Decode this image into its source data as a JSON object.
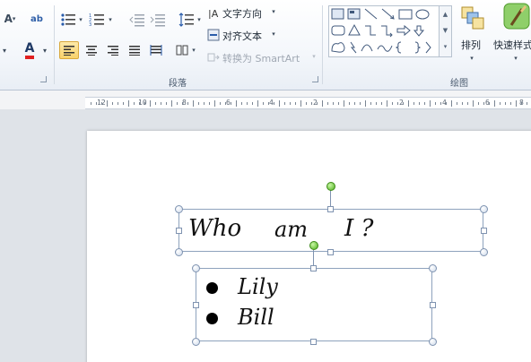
{
  "ribbon": {
    "paragraph_group_label": "段落",
    "drawing_group_label": "绘图",
    "text_direction_label": "文字方向",
    "align_text_label": "对齐文本",
    "convert_smartart_label": "转换为 SmartArt",
    "arrange_label": "排列",
    "quick_styles_label": "快速样式"
  },
  "ruler": {
    "numbers": [
      "12",
      "10",
      "8",
      "6",
      "4",
      "2",
      "2",
      "4",
      "6",
      "8"
    ]
  },
  "document": {
    "title_box": {
      "word1": "Who",
      "word2": "am",
      "word3": "I ?"
    },
    "list_box": {
      "items": [
        "Lily",
        "Bill"
      ]
    }
  },
  "colors": {
    "font_color_underline": "#e02020",
    "rotate_handle": "#4fb11d",
    "selection_border": "#8ea2bd"
  }
}
